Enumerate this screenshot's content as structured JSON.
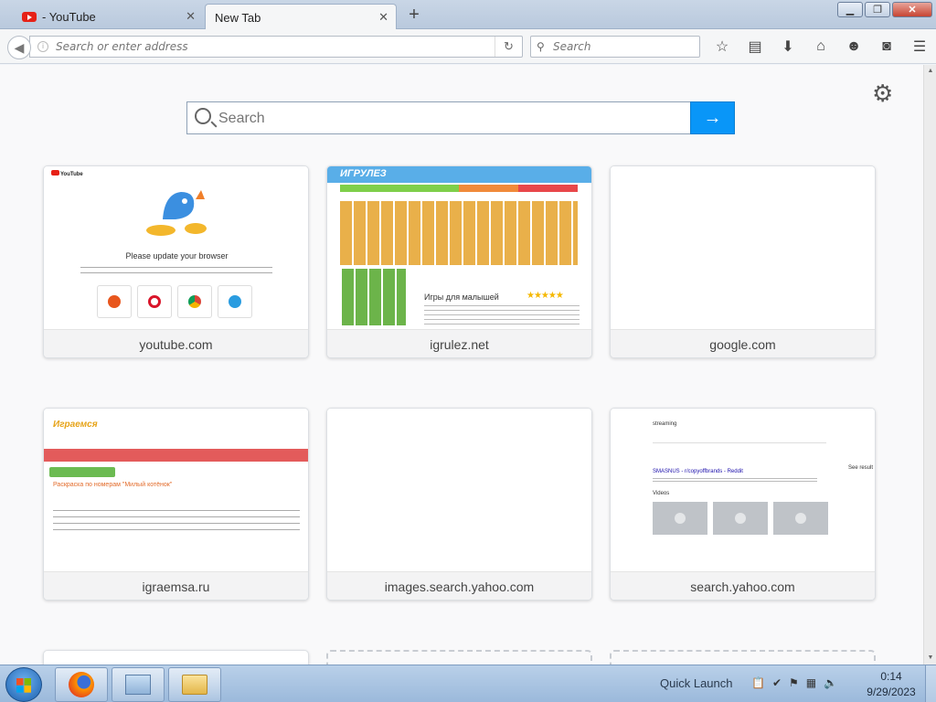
{
  "tabs": [
    {
      "label": "- YouTube",
      "close": "✕"
    },
    {
      "label": "New Tab",
      "close": "✕"
    }
  ],
  "new_tab_symbol": "+",
  "window_buttons": {
    "minimize": "▁",
    "maximize": "❐",
    "close": "✕"
  },
  "navbar": {
    "url_placeholder": "Search or enter address",
    "search_placeholder": "Search",
    "icons": [
      "star-icon",
      "reading-list-icon",
      "download-icon",
      "home-icon",
      "smiley-icon",
      "pocket-icon",
      "menu-icon"
    ]
  },
  "newtab": {
    "search_placeholder": "Search",
    "go_symbol": "→",
    "tiles": [
      {
        "label": "youtube.com"
      },
      {
        "label": "igrulez.net"
      },
      {
        "label": "google.com"
      },
      {
        "label": "igraemsa.ru"
      },
      {
        "label": "images.search.yahoo.com"
      },
      {
        "label": "search.yahoo.com"
      }
    ],
    "thumb_texts": {
      "youtube_title": "Please update your browser",
      "igrulez_logo": "ИГРУЛЕЗ",
      "igrulez_heading": "Игры для малышей",
      "igraemsa_logo": "Играемся",
      "igraemsa_title": "Раскраска по номерам \"Милый котёнок\"",
      "yahoo_query": "streaming",
      "yahoo_link": "SMASNUS - r/copyoffbrands - Reddit",
      "yahoo_videos": "Videos",
      "yahoo_see": "See result"
    }
  },
  "taskbar": {
    "quick_launch": "Quick Launch",
    "time": "0:14",
    "date": "9/29/2023"
  },
  "colors": {
    "accent": "#0996f8",
    "youtube_red": "#e62117"
  }
}
